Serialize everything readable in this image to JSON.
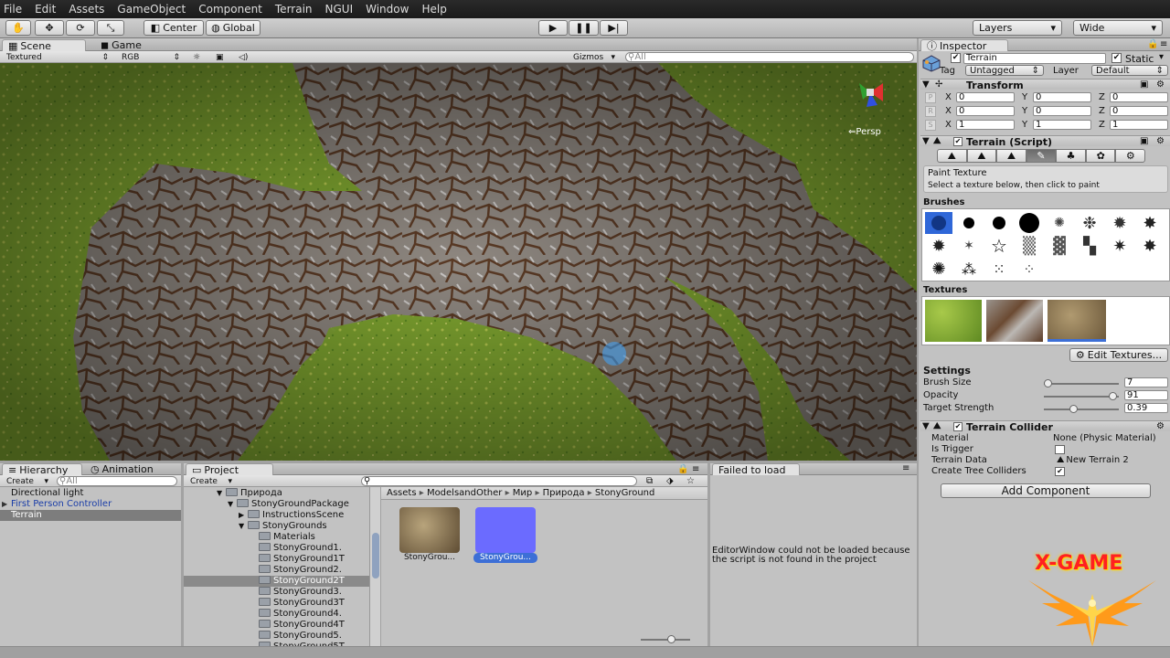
{
  "menu": [
    "File",
    "Edit",
    "Assets",
    "GameObject",
    "Component",
    "Terrain",
    "NGUI",
    "Window",
    "Help"
  ],
  "toolbar": {
    "pivot": "Center",
    "space": "Global",
    "layers": "Layers",
    "layout": "Wide"
  },
  "scene": {
    "tabs": [
      "Scene",
      "Game"
    ],
    "render_mode": "Textured",
    "color_mode": "RGB",
    "gizmos": "Gizmos",
    "search_placeholder": "All",
    "persp": "Persp"
  },
  "hierarchy": {
    "tabs": [
      "Hierarchy",
      "Animation"
    ],
    "create": "Create",
    "search_placeholder": "All",
    "items": [
      {
        "label": "Directional light",
        "color": "#111111",
        "selected": false,
        "arrow": false
      },
      {
        "label": "First Person Controller",
        "color": "#1a3da8",
        "selected": false,
        "arrow": true
      },
      {
        "label": "Terrain",
        "color": "#ffffff",
        "selected": true,
        "arrow": false
      }
    ]
  },
  "project": {
    "tab": "Project",
    "create": "Create",
    "tree": [
      {
        "label": "Природа",
        "indent": 0,
        "arrow": "▼"
      },
      {
        "label": "StonyGroundPackage",
        "indent": 1,
        "arrow": "▼"
      },
      {
        "label": "InstructionsScene",
        "indent": 2,
        "arrow": "▶"
      },
      {
        "label": "StonyGrounds",
        "indent": 2,
        "arrow": "▼"
      },
      {
        "label": "Materials",
        "indent": 3,
        "arrow": ""
      },
      {
        "label": "StonyGround1.",
        "indent": 3,
        "arrow": ""
      },
      {
        "label": "StonyGround1T",
        "indent": 3,
        "arrow": ""
      },
      {
        "label": "StonyGround2.",
        "indent": 3,
        "arrow": ""
      },
      {
        "label": "StonyGround2T",
        "indent": 3,
        "arrow": "",
        "selected": true
      },
      {
        "label": "StonyGround3.",
        "indent": 3,
        "arrow": ""
      },
      {
        "label": "StonyGround3T",
        "indent": 3,
        "arrow": ""
      },
      {
        "label": "StonyGround4.",
        "indent": 3,
        "arrow": ""
      },
      {
        "label": "StonyGround4T",
        "indent": 3,
        "arrow": ""
      },
      {
        "label": "StonyGround5.",
        "indent": 3,
        "arrow": ""
      },
      {
        "label": "StonyGround5T",
        "indent": 3,
        "arrow": ""
      }
    ],
    "breadcrumb": [
      "Assets",
      "ModelsandOther",
      "Мир",
      "Природа",
      "StonyGround"
    ],
    "assets": [
      {
        "label": "StonyGrou...",
        "kind": "texture",
        "selected": false
      },
      {
        "label": "StonyGrou...",
        "kind": "material",
        "selected": true
      }
    ]
  },
  "failed": {
    "tab": "Failed to load",
    "message": "EditorWindow could not be loaded because the script is not found in the project"
  },
  "inspector": {
    "tab": "Inspector",
    "object_name": "Terrain",
    "static_label": "Static",
    "tag_label": "Tag",
    "tag_value": "Untagged",
    "layer_label": "Layer",
    "layer_value": "Default",
    "transform": {
      "title": "Transform",
      "rows": [
        {
          "icon": "P",
          "x": "0",
          "y": "0",
          "z": "0"
        },
        {
          "icon": "R",
          "x": "0",
          "y": "0",
          "z": "0"
        },
        {
          "icon": "S",
          "x": "1",
          "y": "1",
          "z": "1"
        }
      ],
      "axis": [
        "X",
        "Y",
        "Z"
      ]
    },
    "terrain": {
      "title": "Terrain (Script)",
      "hint_title": "Paint Texture",
      "hint_text": "Select a texture below, then click to paint",
      "brushes_label": "Brushes",
      "textures_label": "Textures",
      "edit_textures": "Edit Textures...",
      "settings_label": "Settings",
      "settings": [
        {
          "label": "Brush Size",
          "value": "7",
          "fraction": 0.05
        },
        {
          "label": "Opacity",
          "value": "91",
          "fraction": 0.91
        },
        {
          "label": "Target Strength",
          "value": "0.39",
          "fraction": 0.39
        }
      ]
    },
    "collider": {
      "title": "Terrain Collider",
      "rows": [
        {
          "label": "Material",
          "value": "None (Physic Material)"
        },
        {
          "label": "Is Trigger",
          "value": ""
        },
        {
          "label": "Terrain Data",
          "value": "New Terrain 2"
        },
        {
          "label": "Create Tree Colliders",
          "value": ""
        }
      ],
      "is_trigger": false,
      "create_tree_colliders": true
    },
    "add_component": "Add Component"
  },
  "watermark": "X-GAME"
}
